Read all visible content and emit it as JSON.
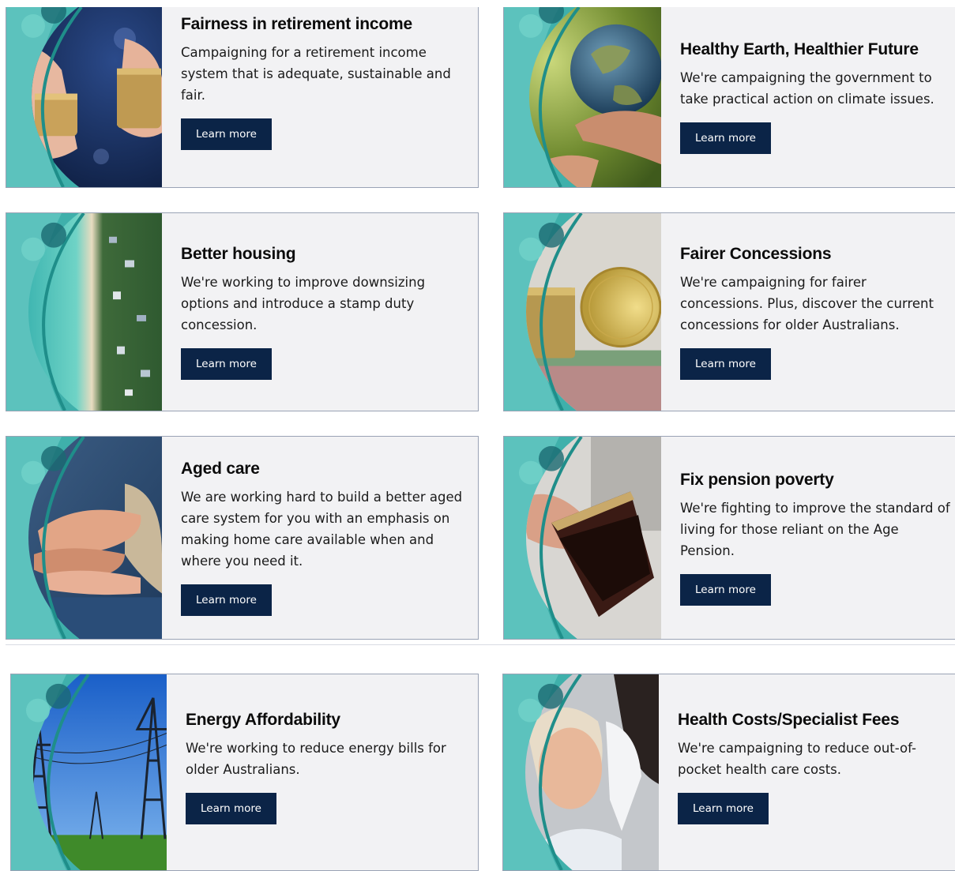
{
  "cards": [
    {
      "title": "Fairness in retirement income",
      "text": "Campaigning for a retirement income system that is adequate, sustainable and fair.",
      "button": "Learn more"
    },
    {
      "title": "Healthy Earth, Healthier Future",
      "text": "We're campaigning the government to take practical action on climate issues.",
      "button": "Learn more"
    },
    {
      "title": "Better housing",
      "text": "We're working to improve downsizing options and introduce a stamp duty concession.",
      "button": "Learn more"
    },
    {
      "title": "Fairer Concessions",
      "text": "We're campaigning for fairer concessions. Plus, discover the current concessions for older Australians.",
      "button": "Learn more"
    },
    {
      "title": "Aged care",
      "text": "We are working hard to build a better aged care system for you with an emphasis on making home care available when and where you need it.",
      "button": "Learn more"
    },
    {
      "title": "Fix pension poverty",
      "text": "We're fighting to improve the standard of living for those reliant on the Age Pension.",
      "button": "Learn more"
    },
    {
      "title": "Energy Affordability",
      "text": "We're working to reduce energy bills for older Australians.",
      "button": "Learn more"
    },
    {
      "title": "Health Costs/Specialist Fees",
      "text": "We're campaigning to reduce out-of-pocket health care costs.",
      "button": "Learn more"
    }
  ],
  "colors": {
    "card_bg": "#f2f2f4",
    "button_bg": "#0b2447",
    "accent_teal": "#3aa7a3",
    "accent_navy": "#0e3b5a"
  }
}
